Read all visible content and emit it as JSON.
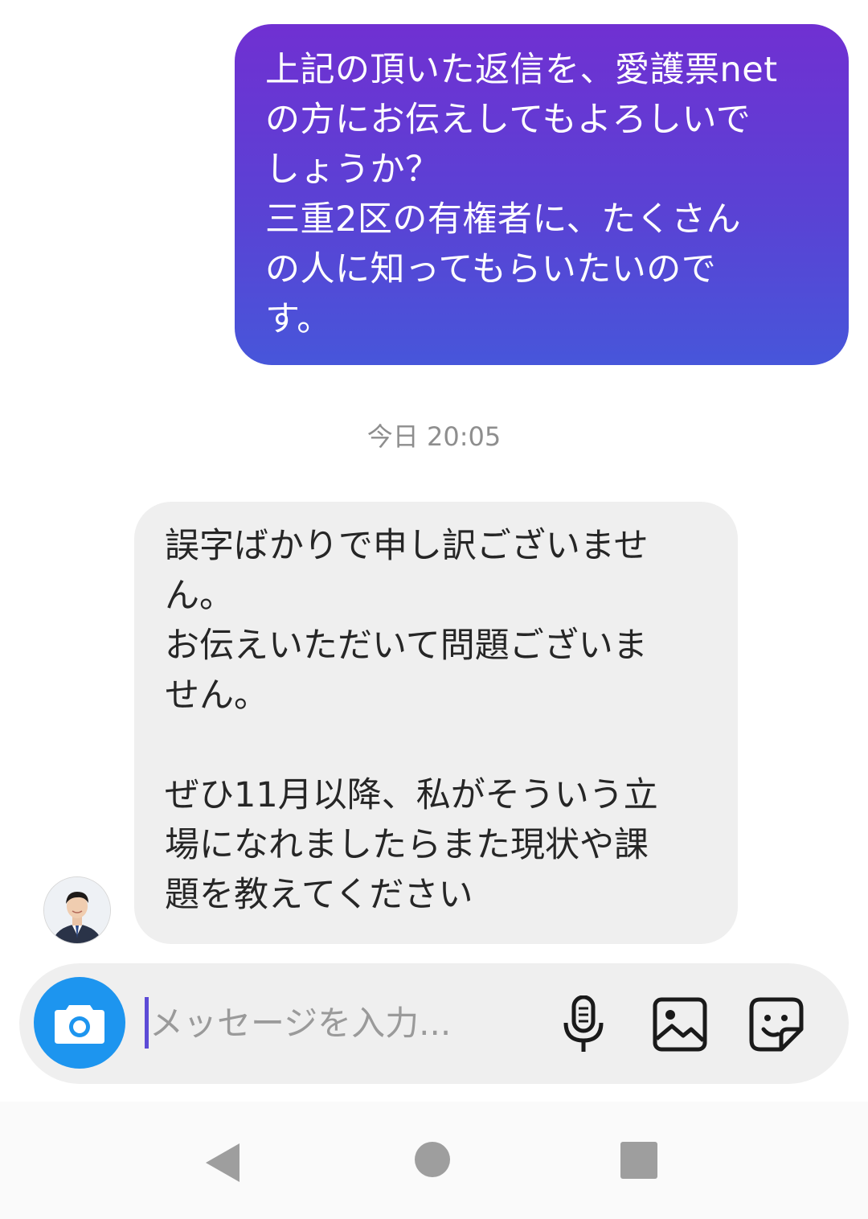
{
  "messages": {
    "sent": {
      "text": "上記の頂いた返信を、愛護票net\nの方にお伝えしてもよろしいで\nしょうか？\n三重2区の有権者に、たくさん\nの人に知ってもらいたいので\nす。"
    },
    "timestamp": "今日 20:05",
    "received": {
      "text": "誤字ばかりで申し訳ございませ\nん。\nお伝えいただいて問題ございま\nせん。\n\nぜひ11月以降、私がそういう立\n場になれましたらまた現状や課\n題を教えてください"
    }
  },
  "composer": {
    "placeholder": "メッセージを入力...",
    "value": "",
    "icons": [
      "camera-icon",
      "microphone-icon",
      "image-icon",
      "sticker-icon"
    ]
  },
  "nav": {
    "icons": [
      "back-icon",
      "home-icon",
      "recents-icon"
    ]
  },
  "colors": {
    "sent_bubble_top": "#7030d2",
    "sent_bubble_bottom": "#4756da",
    "received_bubble": "#efefef",
    "camera_button": "#1d95ef",
    "caret": "#5c4bd6"
  }
}
